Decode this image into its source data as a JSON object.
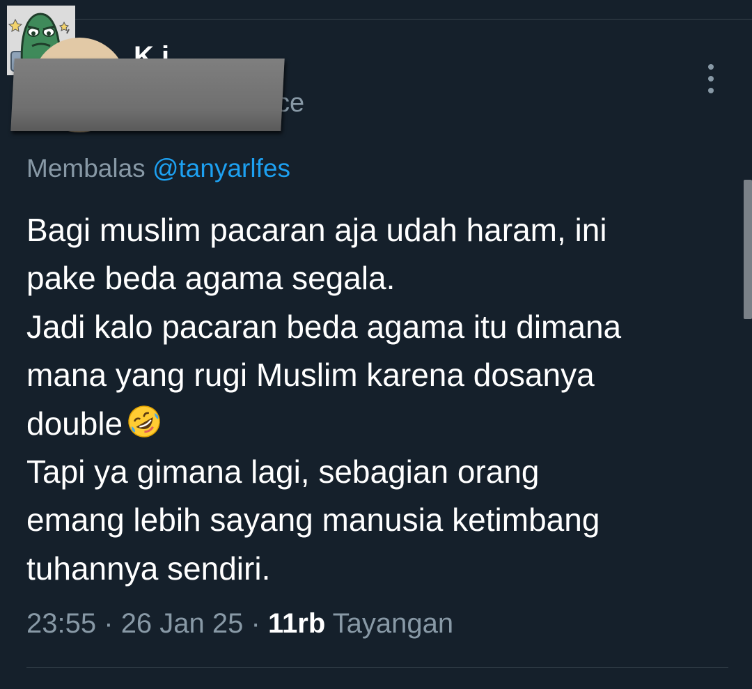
{
  "author": {
    "name_partial": "K  i",
    "handle_partial": "ce"
  },
  "reply": {
    "prefix": "Membalas",
    "mention": "@tanyarlfes"
  },
  "tweet": {
    "lines": [
      "Bagi muslim pacaran aja udah haram, ini",
      "pake beda agama segala.",
      "Jadi kalo pacaran beda agama itu dimana",
      "mana yang rugi Muslim karena dosanya",
      "double",
      "Tapi ya gimana lagi, sebagian orang",
      "emang lebih sayang manusia ketimbang",
      "tuhannya sendiri."
    ],
    "emoji": "rolling-on-the-floor-laughing"
  },
  "meta": {
    "time": "23:55",
    "separator": "·",
    "date": "26 Jan 25",
    "views_count": "11rb",
    "views_label": "Tayangan"
  },
  "icons": {
    "more": "more-vertical-icon",
    "sticker": "sticker-image"
  },
  "colors": {
    "background": "#15202b",
    "text_primary": "#ffffff",
    "text_secondary": "#8899a6",
    "accent": "#1da1f2",
    "divider": "#38444d"
  }
}
